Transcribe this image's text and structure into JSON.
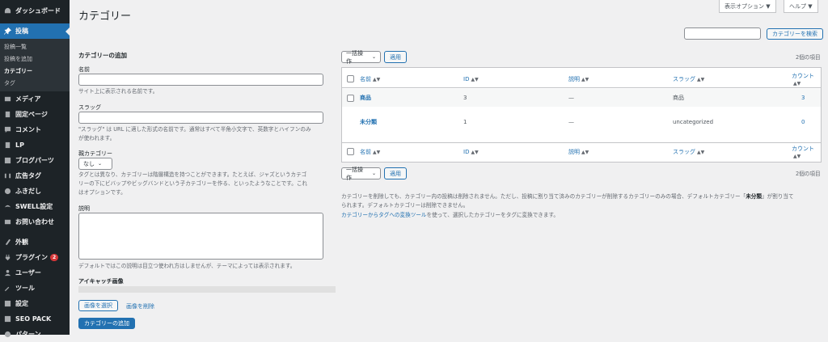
{
  "sidebar": {
    "items": [
      {
        "label": "ダッシュボード",
        "icon": "dashboard-icon"
      },
      {
        "label": "投稿",
        "icon": "pin-icon"
      },
      {
        "label": "メディア",
        "icon": "media-icon"
      },
      {
        "label": "固定ページ",
        "icon": "page-icon"
      },
      {
        "label": "コメント",
        "icon": "comment-icon"
      },
      {
        "label": "LP",
        "icon": "lp-icon"
      },
      {
        "label": "ブログパーツ",
        "icon": "blogparts-icon"
      },
      {
        "label": "広告タグ",
        "icon": "adtag-icon"
      },
      {
        "label": "ふきだし",
        "icon": "balloon-icon"
      },
      {
        "label": "SWELL設定",
        "icon": "swell-icon"
      },
      {
        "label": "お問い合わせ",
        "icon": "mail-icon"
      },
      {
        "label": "外観",
        "icon": "appearance-icon"
      },
      {
        "label": "プラグイン",
        "icon": "plugin-icon",
        "badge": "2"
      },
      {
        "label": "ユーザー",
        "icon": "user-icon"
      },
      {
        "label": "ツール",
        "icon": "tool-icon"
      },
      {
        "label": "設定",
        "icon": "settings-icon"
      },
      {
        "label": "SEO PACK",
        "icon": "seo-icon"
      },
      {
        "label": "パターン",
        "icon": "pattern-icon"
      }
    ],
    "sub": [
      "投稿一覧",
      "投稿を追加",
      "カテゴリー",
      "タグ"
    ]
  },
  "header": {
    "title": "カテゴリー",
    "screen_options": "表示オプション ▼",
    "help": "ヘルプ ▼",
    "search_button": "カテゴリーを検索",
    "search_value": ""
  },
  "form": {
    "heading": "カテゴリーの追加",
    "name_label": "名前",
    "name_value": "",
    "name_desc": "サイト上に表示される名前です。",
    "slug_label": "スラッグ",
    "slug_value": "",
    "slug_desc1": "\"スラッグ\" は URL に適した形式の名前です。通常はすべて半角小文字で、英数字とハイフンのみ",
    "slug_desc2": "が使われます。",
    "parent_label": "親カテゴリー",
    "parent_value": "なし",
    "parent_desc1": "タグとは異なり、カテゴリーは階層構造を持つことができます。たとえば、ジャズというカテゴ",
    "parent_desc2": "リーの下にビバップやビッグバンドという子カテゴリーを作る、といったようなことです。これ",
    "parent_desc3": "はオプションです。",
    "desc_label": "説明",
    "desc_value": "",
    "desc_desc": "デフォルトではこの説明は目立つ使われ方はしませんが、テーマによっては表示されます。",
    "eyecatch_label": "アイキャッチ画像",
    "select_image": "画像を選択",
    "remove_image": "画像を削除",
    "submit": "カテゴリーの追加"
  },
  "list": {
    "bulk": "一括操作",
    "apply": "適用",
    "count": "2個の項目",
    "columns": {
      "name": "名前",
      "id": "ID",
      "desc": "説明",
      "slug": "スラッグ",
      "count": "カウント"
    },
    "rows": [
      {
        "name": "商品",
        "id": "3",
        "desc": "—",
        "slug": "商品",
        "count": "3"
      },
      {
        "name": "未分類",
        "id": "1",
        "desc": "—",
        "slug": "uncategorized",
        "count": "0"
      }
    ],
    "note1": "カテゴリーを削除しても、カテゴリー内の投稿は削除されません。ただし、投稿に割り当て済みのカテゴリーが削除するカテゴリーのみの場合、デフォルトカテゴリー「",
    "note1_bold": "未分類",
    "note1_end": "」が割り当て",
    "note2": "られます。デフォルトカテゴリーは削除できません。",
    "note3_link": "カテゴリーからタグへの変換ツール",
    "note3": "を使って、選択したカテゴリーをタグに変換できます。"
  }
}
